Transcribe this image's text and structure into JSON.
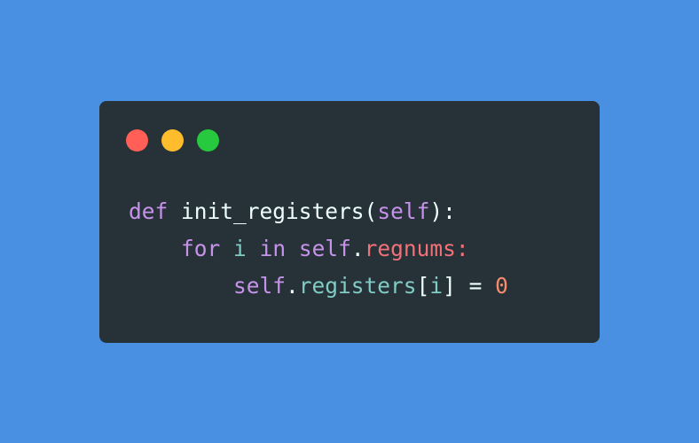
{
  "window": {
    "controls": [
      {
        "name": "close",
        "color": "#ff5f56"
      },
      {
        "name": "minimize",
        "color": "#ffbd2e"
      },
      {
        "name": "maximize",
        "color": "#27c93f"
      }
    ]
  },
  "colors": {
    "background": "#4a90e2",
    "editor": "#263238",
    "keyword": "#c792ea",
    "text": "#eeffff",
    "variable": "#80cbc4",
    "attribute": "#f07178",
    "number": "#f78c6c"
  },
  "code": {
    "line1": {
      "kw_def": "def",
      "fn_name": "init_registers",
      "paren_open": "(",
      "self": "self",
      "paren_close": "):"
    },
    "line2": {
      "indent": "    ",
      "kw_for": "for",
      "var_i": "i",
      "kw_in": "in",
      "self": "self",
      "dot": ".",
      "attr": "regnums",
      "colon": ":"
    },
    "line3": {
      "indent": "        ",
      "self": "self",
      "dot": ".",
      "attr": "registers",
      "bracket_open": "[",
      "var_i": "i",
      "bracket_close": "]",
      "eq": " = ",
      "num": "0"
    }
  }
}
